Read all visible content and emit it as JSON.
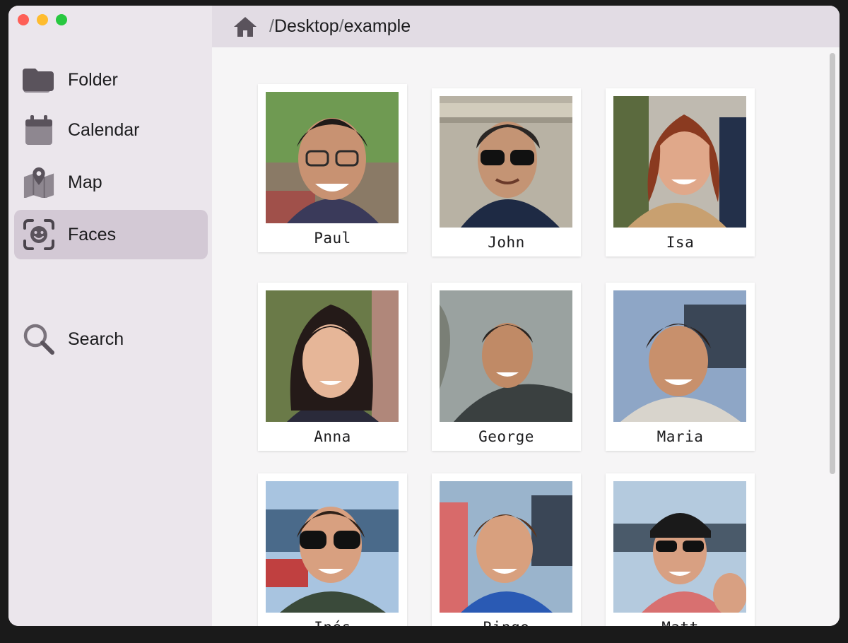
{
  "window": {
    "traffic_lights": [
      "close",
      "minimize",
      "maximize"
    ]
  },
  "sidebar": {
    "items": [
      {
        "label": "Folder",
        "icon": "folder-icon",
        "active": false
      },
      {
        "label": "Calendar",
        "icon": "calendar-icon",
        "active": false
      },
      {
        "label": "Map",
        "icon": "map-icon",
        "active": false
      },
      {
        "label": "Faces",
        "icon": "face-scan-icon",
        "active": true
      },
      {
        "label": "Search",
        "icon": "magnifier-icon",
        "active": false
      }
    ]
  },
  "header": {
    "icon": "home-icon",
    "path_sep": "/",
    "path_parts": [
      "Desktop",
      "example"
    ]
  },
  "faces": [
    {
      "name": "Paul"
    },
    {
      "name": "John"
    },
    {
      "name": "Isa"
    },
    {
      "name": "Anna"
    },
    {
      "name": "George"
    },
    {
      "name": "Maria"
    },
    {
      "name": "Inés"
    },
    {
      "name": "Ringo"
    },
    {
      "name": "Matt"
    }
  ],
  "colors": {
    "sidebar_bg": "#ebe6ec",
    "active_item_bg": "#d3c9d5",
    "header_bg": "#e2dce4",
    "content_bg": "#f6f5f6",
    "icon_color": "#5a535c"
  }
}
